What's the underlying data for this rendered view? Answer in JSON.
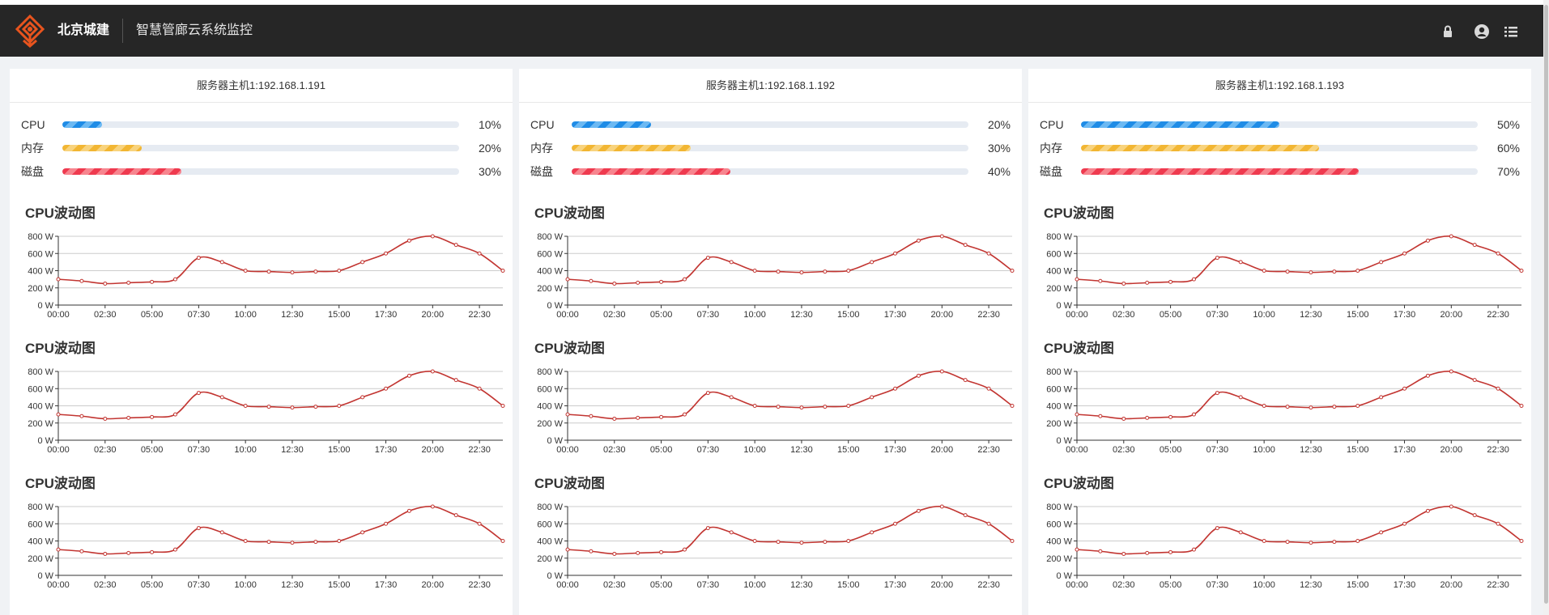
{
  "header": {
    "brand": "北京城建",
    "subtitle": "智慧管廊云系统监控",
    "icons": [
      "lock-icon",
      "user-icon",
      "menu-list-icon"
    ]
  },
  "labels": {
    "cpu": "CPU",
    "memory": "内存",
    "disk": "磁盘"
  },
  "servers": [
    {
      "title": "服务器主机1:192.168.1.191",
      "cpu": 10,
      "cpu_text": "10%",
      "memory": 20,
      "memory_text": "20%",
      "disk": 30,
      "disk_text": "30%",
      "charts": [
        {
          "title": "CPU波动图"
        },
        {
          "title": "CPU波动图"
        },
        {
          "title": "CPU波动图"
        }
      ]
    },
    {
      "title": "服务器主机1:192.168.1.192",
      "cpu": 20,
      "cpu_text": "20%",
      "memory": 30,
      "memory_text": "30%",
      "disk": 40,
      "disk_text": "40%",
      "charts": [
        {
          "title": "CPU波动图"
        },
        {
          "title": "CPU波动图"
        },
        {
          "title": "CPU波动图"
        }
      ]
    },
    {
      "title": "服务器主机1:192.168.1.193",
      "cpu": 50,
      "cpu_text": "50%",
      "memory": 60,
      "memory_text": "60%",
      "disk": 70,
      "disk_text": "70%",
      "charts": [
        {
          "title": "CPU波动图"
        },
        {
          "title": "CPU波动图"
        },
        {
          "title": "CPU波动图"
        }
      ]
    }
  ],
  "chart_data": {
    "type": "line",
    "title": "CPU波动图",
    "x_ticks": [
      "00:00",
      "02:30",
      "05:00",
      "07:30",
      "10:00",
      "12:30",
      "15:00",
      "17:30",
      "20:00",
      "22:30"
    ],
    "y_ticks": [
      "0 W",
      "200 W",
      "400 W",
      "600 W",
      "800 W"
    ],
    "ylim": [
      0,
      800
    ],
    "xlim_minutes": [
      0,
      1425
    ],
    "grid": "horizontal",
    "line_color": "#c23531",
    "points": [
      {
        "x": "00:00",
        "y": 300
      },
      {
        "x": "01:15",
        "y": 280
      },
      {
        "x": "02:30",
        "y": 250
      },
      {
        "x": "03:45",
        "y": 260
      },
      {
        "x": "05:00",
        "y": 270
      },
      {
        "x": "06:15",
        "y": 300
      },
      {
        "x": "07:30",
        "y": 550
      },
      {
        "x": "08:45",
        "y": 500
      },
      {
        "x": "10:00",
        "y": 400
      },
      {
        "x": "11:15",
        "y": 390
      },
      {
        "x": "12:30",
        "y": 380
      },
      {
        "x": "13:45",
        "y": 390
      },
      {
        "x": "15:00",
        "y": 400
      },
      {
        "x": "16:15",
        "y": 500
      },
      {
        "x": "17:30",
        "y": 600
      },
      {
        "x": "18:45",
        "y": 750
      },
      {
        "x": "20:00",
        "y": 800
      },
      {
        "x": "21:15",
        "y": 700
      },
      {
        "x": "22:30",
        "y": 600
      },
      {
        "x": "23:45",
        "y": 400
      }
    ]
  }
}
